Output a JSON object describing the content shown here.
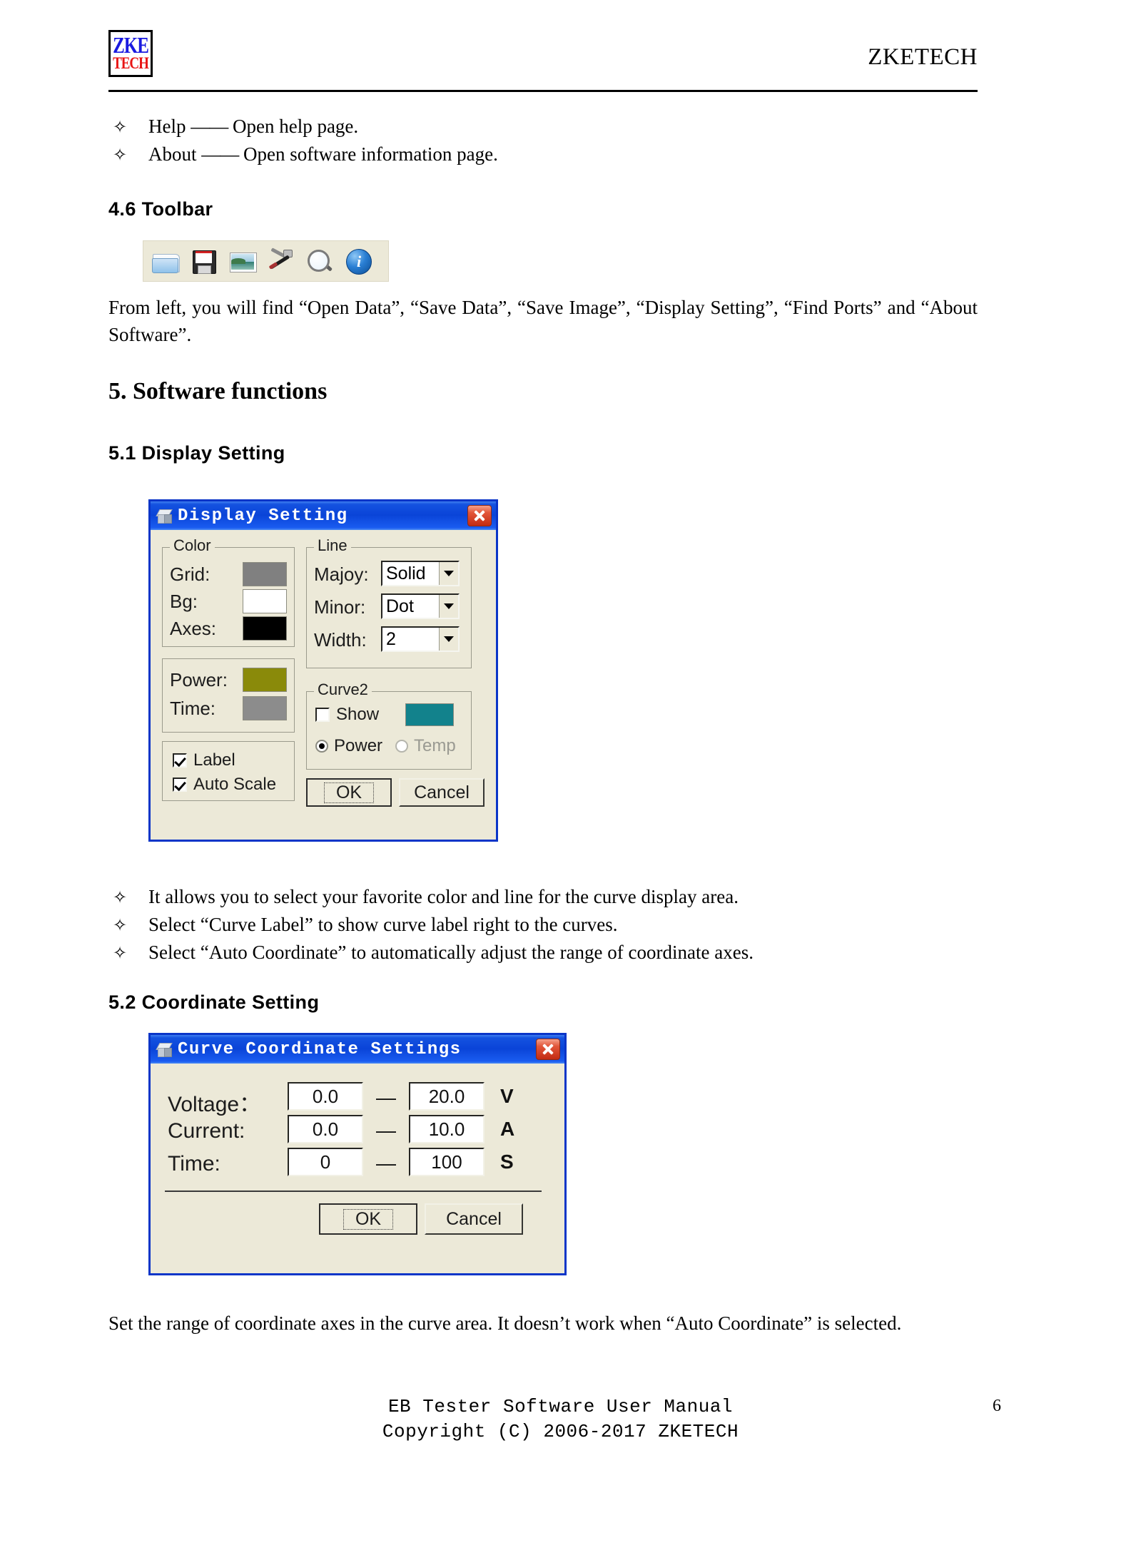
{
  "header": {
    "logo_top": "ZKE",
    "logo_bottom": "TECH",
    "title": "ZKETECH"
  },
  "top_bullets": [
    {
      "mark": "✧",
      "term": "Help",
      "dash": "——",
      "desc": "Open help page."
    },
    {
      "mark": "✧",
      "term": "About",
      "dash": "——",
      "desc": "Open software information page."
    }
  ],
  "section_46": {
    "heading": "4.6 Toolbar",
    "toolbar_icons": [
      "open-data-icon",
      "save-data-icon",
      "save-image-icon",
      "display-setting-icon",
      "find-ports-icon",
      "about-software-icon"
    ],
    "paragraph": "From left, you will find “Open Data”, “Save Data”, “Save Image”, “Display Setting”, “Find Ports” and “About Software”."
  },
  "section_5": {
    "heading": "5. Software functions"
  },
  "section_51": {
    "heading": "5.1 Display Setting",
    "dialog": {
      "title": "Display Setting",
      "close_label": "×",
      "color_group": {
        "legend": "Color",
        "rows": [
          {
            "label": "Grid:",
            "color": "#808080"
          },
          {
            "label": "Bg:",
            "color": "#ffffff"
          },
          {
            "label": "Axes:",
            "color": "#000000"
          }
        ]
      },
      "power_group": {
        "rows": [
          {
            "label": "Power:",
            "color": "#8a8a0a"
          },
          {
            "label": "Time:",
            "color": "#8c8c8c"
          }
        ]
      },
      "checkboxes": [
        {
          "label": "Label",
          "checked": true
        },
        {
          "label": "Auto Scale",
          "checked": true
        }
      ],
      "line_group": {
        "legend": "Line",
        "rows": [
          {
            "label": "Majoy:",
            "value": "Solid"
          },
          {
            "label": "Minor:",
            "value": "Dot"
          },
          {
            "label": "Width:",
            "value": "2"
          }
        ]
      },
      "curve2_group": {
        "legend": "Curve2",
        "show_label": "Show",
        "show_checked": false,
        "color": "#12828c",
        "radios": [
          {
            "label": "Power",
            "selected": true,
            "disabled": false
          },
          {
            "label": "Temp",
            "selected": false,
            "disabled": true
          }
        ]
      },
      "buttons": {
        "ok": "OK",
        "cancel": "Cancel"
      }
    },
    "bullets": [
      {
        "mark": "✧",
        "text": "It allows you to select your favorite color and line for the curve display area."
      },
      {
        "mark": "✧",
        "text": "Select “Curve Label” to show curve label right to the curves."
      },
      {
        "mark": "✧",
        "text": "Select “Auto Coordinate” to automatically adjust the range of coordinate axes."
      }
    ]
  },
  "section_52": {
    "heading": "5.2 Coordinate Setting",
    "dialog": {
      "title": "Curve Coordinate Settings",
      "close_label": "×",
      "rows": [
        {
          "label": "Voltage：",
          "min": "0.0",
          "sep": "—",
          "max": "20.0",
          "unit": "V"
        },
        {
          "label": "Current:",
          "min": "0.0",
          "sep": "—",
          "max": "10.0",
          "unit": "A"
        },
        {
          "label": "Time:",
          "min": "0",
          "sep": "—",
          "max": "100",
          "unit": "S"
        }
      ],
      "buttons": {
        "ok": "OK",
        "cancel": "Cancel"
      }
    },
    "paragraph": "Set the range of coordinate axes in the curve area. It doesn’t work when “Auto Coordinate” is selected."
  },
  "footer": {
    "line1": "EB Tester Software User Manual",
    "line2": "Copyright (C) 2006-2017 ZKETECH",
    "page_number": "6"
  }
}
